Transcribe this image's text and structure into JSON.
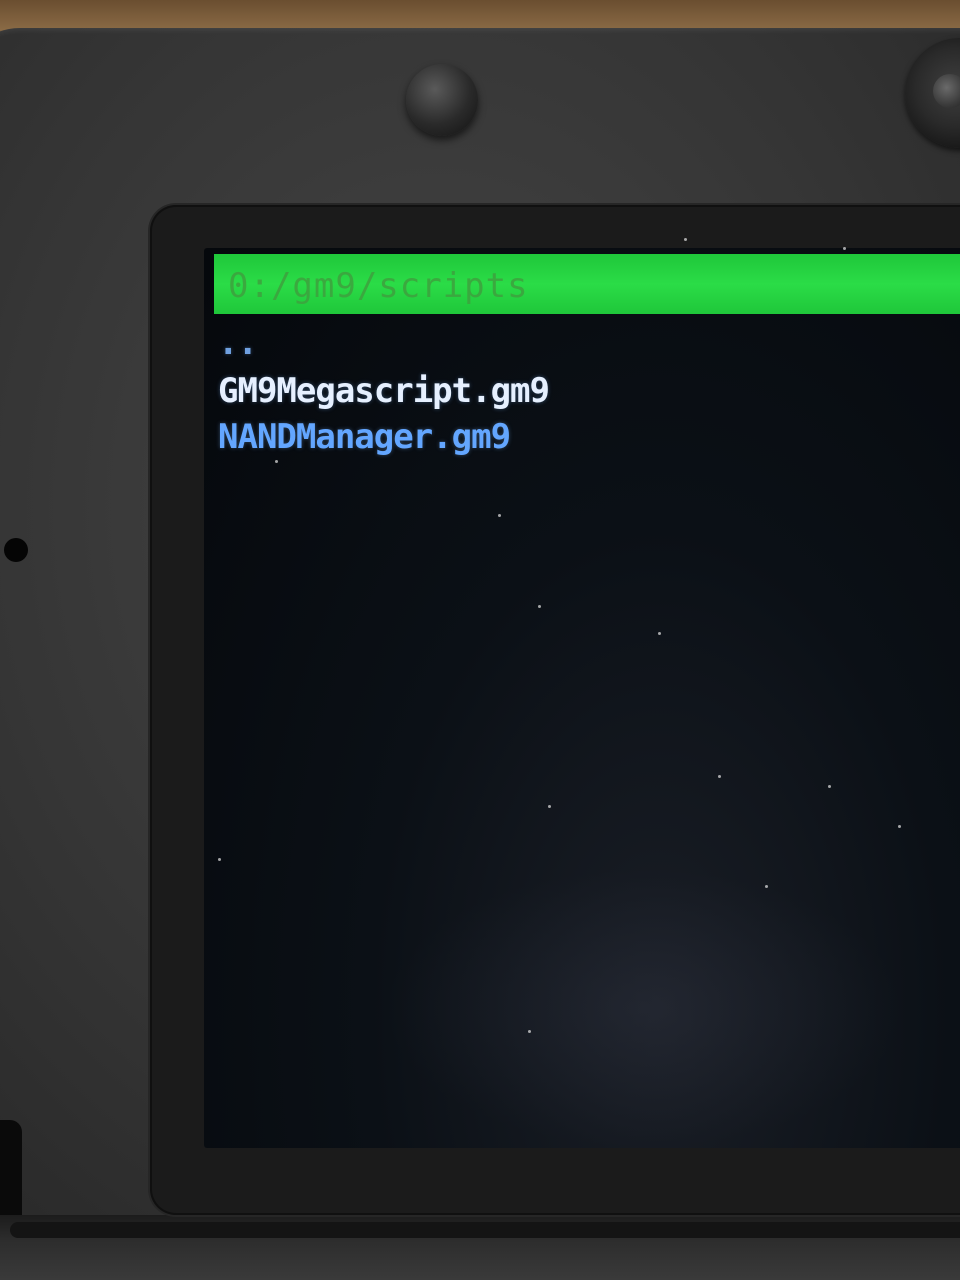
{
  "file_browser": {
    "path": "0:/gm9/scripts",
    "entries": [
      {
        "label": "..",
        "state": "parent"
      },
      {
        "label": "GM9Megascript.gm9",
        "state": "selected"
      },
      {
        "label": "NANDManager.gm9",
        "state": "normal"
      }
    ]
  },
  "colors": {
    "title_bar": "#2bdc47",
    "selected_text": "#e6f0ff",
    "entry_text": "#63a6ff",
    "screen_background": "#05080c"
  }
}
